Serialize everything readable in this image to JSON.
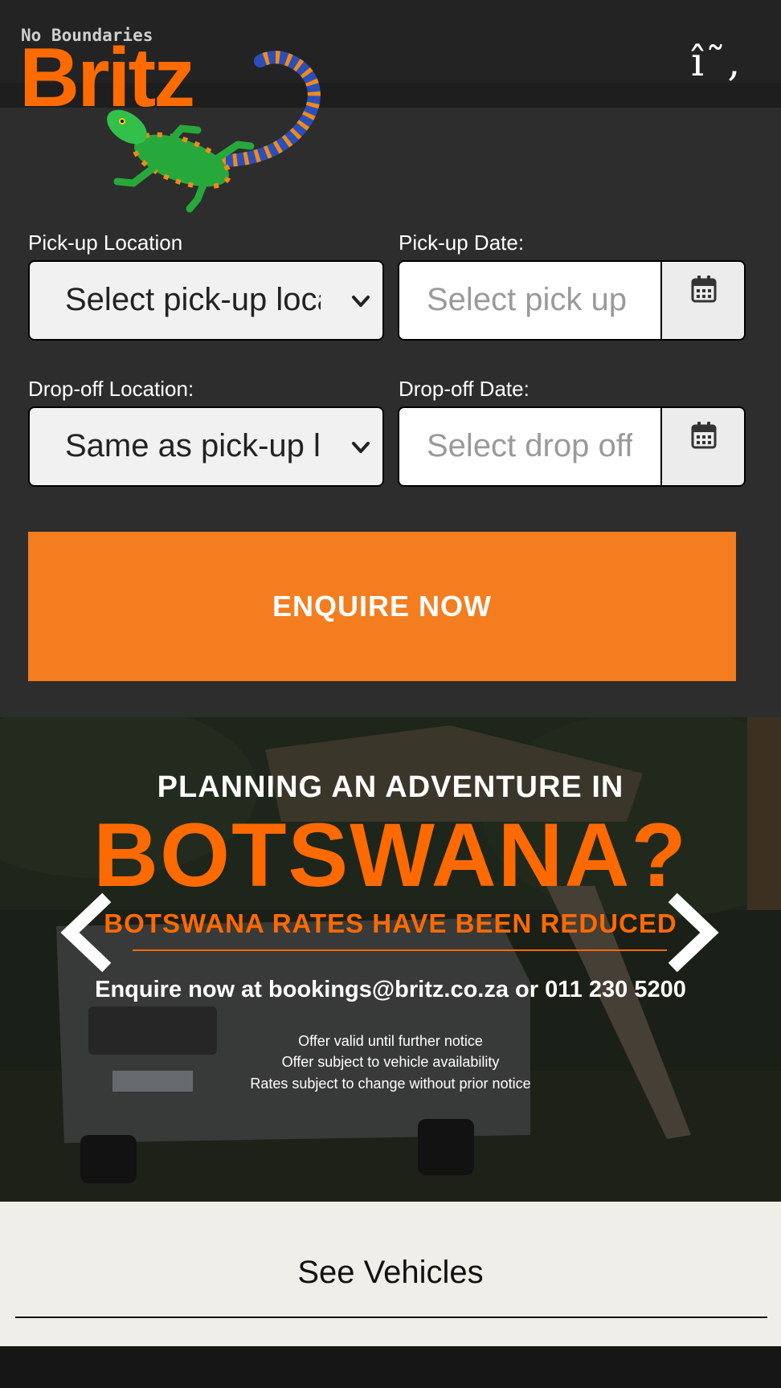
{
  "header": {
    "logo": {
      "tagline": "No Boundaries",
      "wordmark": "Britz",
      "mascot": "lizard-logo"
    },
    "menu_glyph": "î˜‚"
  },
  "form": {
    "pickup_location": {
      "label": "Pick-up Location",
      "value": "Select pick-up location"
    },
    "pickup_date": {
      "label": "Pick-up Date:",
      "placeholder": "Select pick up date"
    },
    "dropoff_location": {
      "label": "Drop-off Location:",
      "value": "Same as pick-up location"
    },
    "dropoff_date": {
      "label": "Drop-off Date:",
      "placeholder": "Select drop off date"
    },
    "calendar_icon": "calendar-icon",
    "submit_label": "ENQUIRE NOW"
  },
  "banner": {
    "line1": "PLANNING AN ADVENTURE IN",
    "line2": "BOTSWANA?",
    "line3": "BOTSWANA RATES HAVE BEEN REDUCED",
    "line4": "Enquire now at bookings@britz.co.za or 011 230 5200",
    "notes": [
      "Offer valid until further notice",
      "Offer subject to vehicle availability",
      "Rates subject to change without prior notice"
    ],
    "prev_icon": "chevron-left-icon",
    "next_icon": "chevron-right-icon"
  },
  "vehicles": {
    "label": "See Vehicles"
  },
  "colors": {
    "brand_orange": "#f47d20",
    "banner_orange": "#ff6a00",
    "panel_bg": "#2d2d2d",
    "light_section": "#efeee9"
  }
}
